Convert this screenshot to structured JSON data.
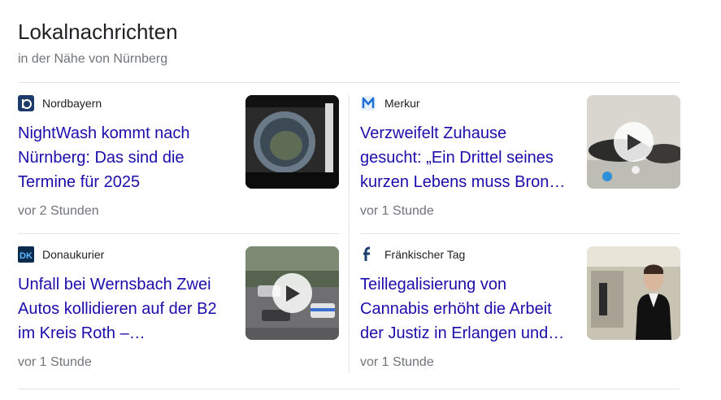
{
  "header": {
    "title": "Lokalnachrichten",
    "subtitle": "in der Nähe von Nürnberg"
  },
  "articles": [
    {
      "source": "Nordbayern",
      "source_icon": "nordbayern-logo-icon",
      "headline": "NightWash kommt nach Nürnberg: Das sind die Termine für 2025",
      "time": "vor 2 Stunden",
      "has_video": false
    },
    {
      "source": "Merkur",
      "source_icon": "merkur-logo-icon",
      "headline": "Verzweifelt Zuhause gesucht: „Ein Drittel seines kurzen Lebens muss Bron…",
      "time": "vor 1 Stunde",
      "has_video": true
    },
    {
      "source": "Donaukurier",
      "source_icon": "donaukurier-logo-icon",
      "headline": "Unfall bei Wernsbach Zwei Autos kollidieren auf der B2 im Kreis Roth –…",
      "time": "vor 1 Stunde",
      "has_video": true
    },
    {
      "source": "Fränkischer Tag",
      "source_icon": "fraenkischer-tag-logo-icon",
      "headline": "Teillegalisierung von Cannabis erhöht die Arbeit der Justiz in Erlangen und…",
      "time": "vor 1 Stunde",
      "has_video": false
    }
  ],
  "colors": {
    "link": "#1a0dab",
    "meta": "#70757a",
    "divider": "#e4e4e4"
  }
}
